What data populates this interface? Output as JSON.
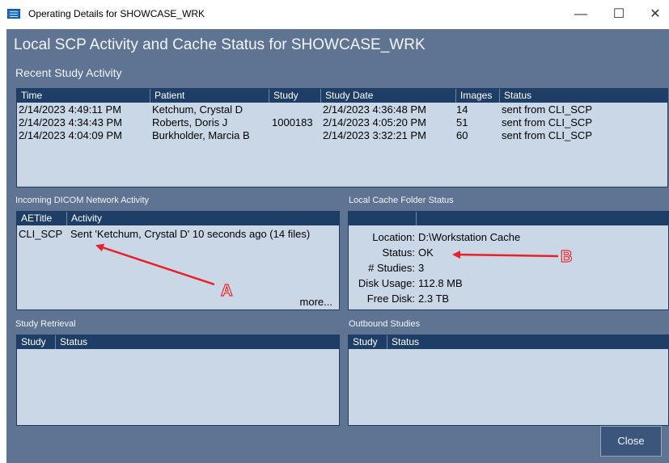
{
  "window": {
    "title": "Operating Details for SHOWCASE_WRK",
    "minimize": "—",
    "maximize": "☐",
    "close": "✕"
  },
  "header": "Local SCP Activity and Cache Status for SHOWCASE_WRK",
  "recent": {
    "label": "Recent Study Activity",
    "columns": [
      "Time",
      "Patient",
      "Study",
      "Study Date",
      "Images",
      "Status"
    ],
    "rows": [
      [
        "2/14/2023 4:49:11 PM",
        "Ketchum, Crystal D",
        "",
        "2/14/2023 4:36:48 PM",
        "14",
        "sent from CLI_SCP"
      ],
      [
        "2/14/2023 4:34:43 PM",
        "Roberts, Doris J",
        "1000183",
        "2/14/2023 4:05:20 PM",
        "51",
        "sent from CLI_SCP"
      ],
      [
        "2/14/2023 4:04:09 PM",
        "Burkholder, Marcia B",
        "",
        "2/14/2023 3:32:21 PM",
        "60",
        "sent from CLI_SCP"
      ]
    ]
  },
  "incoming": {
    "label": "Incoming DICOM Network Activity",
    "columns": [
      "AETitle",
      "Activity"
    ],
    "rows": [
      [
        "CLI_SCP",
        "Sent 'Ketchum, Crystal D' 10 seconds ago (14 files)"
      ]
    ],
    "more": "more..."
  },
  "cache": {
    "label": "Local Cache Folder Status",
    "items": [
      {
        "key": "Location:",
        "value": "D:\\Workstation Cache"
      },
      {
        "key": "Status:",
        "value": "OK"
      },
      {
        "key": "# Studies:",
        "value": "3"
      },
      {
        "key": "Disk Usage:",
        "value": "112.8 MB"
      },
      {
        "key": "Free Disk:",
        "value": "2.3 TB"
      }
    ]
  },
  "retrieval": {
    "label": "Study Retrieval",
    "columns": [
      "Study",
      "Status"
    ]
  },
  "outbound": {
    "label": "Outbound Studies",
    "columns": [
      "Study",
      "Status"
    ]
  },
  "close_label": "Close",
  "annotations": {
    "a": "A",
    "b": "B",
    "arrow_color": "#e8202a"
  }
}
